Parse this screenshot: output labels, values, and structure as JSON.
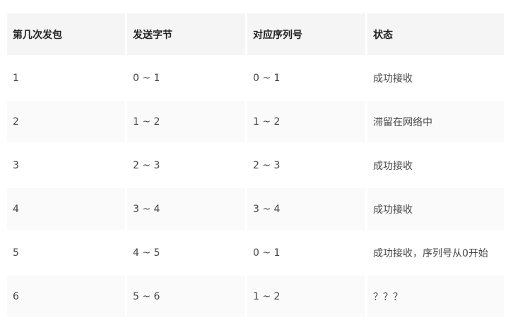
{
  "table": {
    "headers": [
      "第几次发包",
      "发送字节",
      "对应序列号",
      "状态"
    ],
    "rows": [
      [
        "1",
        "0 ~ 1",
        "0 ~ 1",
        "成功接收"
      ],
      [
        "2",
        "1 ~ 2",
        "1 ~ 2",
        "滞留在网络中"
      ],
      [
        "3",
        "2 ~ 3",
        "2 ~ 3",
        "成功接收"
      ],
      [
        "4",
        "3 ~ 4",
        "3 ~ 4",
        "成功接收"
      ],
      [
        "5",
        "4 ~ 5",
        "0 ~ 1",
        "成功接收，序列号从0开始"
      ],
      [
        "6",
        "5 ~ 6",
        "1 ~ 2",
        "？？？"
      ]
    ]
  }
}
